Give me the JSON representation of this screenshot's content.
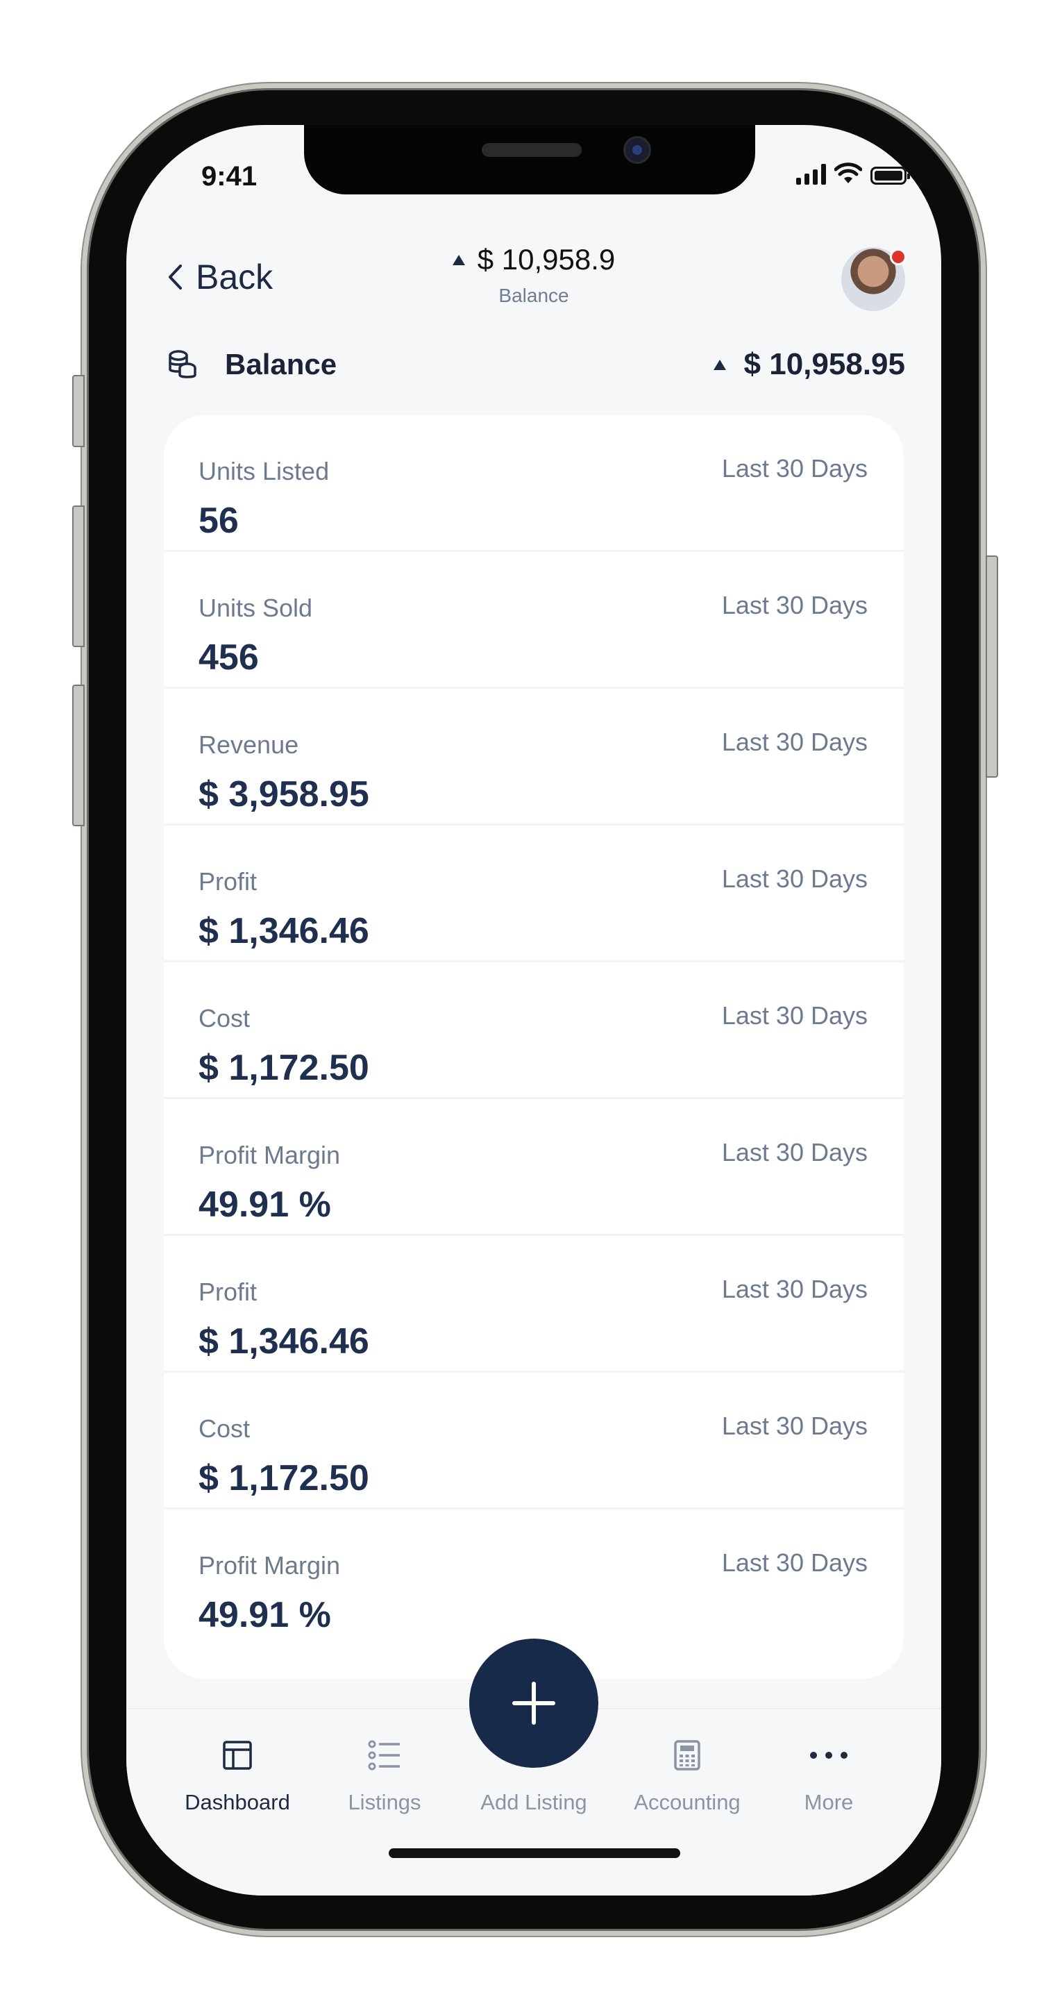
{
  "status": {
    "time": "9:41"
  },
  "header": {
    "back_label": "Back",
    "amount": "$ 10,958.9",
    "subtitle": "Balance"
  },
  "balance": {
    "label": "Balance",
    "value": "$ 10,958.95"
  },
  "metrics": [
    {
      "label": "Units Listed",
      "value": "56",
      "period": "Last 30 Days"
    },
    {
      "label": "Units Sold",
      "value": "456",
      "period": "Last 30 Days"
    },
    {
      "label": "Revenue",
      "value": "$ 3,958.95",
      "period": "Last 30 Days"
    },
    {
      "label": "Profit",
      "value": "$ 1,346.46",
      "period": "Last 30 Days"
    },
    {
      "label": "Cost",
      "value": "$ 1,172.50",
      "period": "Last 30 Days"
    },
    {
      "label": "Profit Margin",
      "value": "49.91 %",
      "period": "Last 30 Days"
    },
    {
      "label": "Profit",
      "value": "$ 1,346.46",
      "period": "Last 30 Days"
    },
    {
      "label": "Cost",
      "value": "$ 1,172.50",
      "period": "Last 30 Days"
    },
    {
      "label": "Profit Margin",
      "value": "49.91 %",
      "period": "Last 30 Days"
    }
  ],
  "tabs": [
    {
      "label": "Dashboard",
      "icon": "dashboard-icon"
    },
    {
      "label": "Listings",
      "icon": "list-icon"
    },
    {
      "label": "Add Listing",
      "icon": "plus-icon"
    },
    {
      "label": "Accounting",
      "icon": "calculator-icon"
    },
    {
      "label": "More",
      "icon": "more-dots-icon"
    }
  ],
  "colors": {
    "primary": "#172a4a",
    "text_muted": "#6c7a90",
    "background": "#f6f7f9",
    "notification": "#e0332b"
  }
}
